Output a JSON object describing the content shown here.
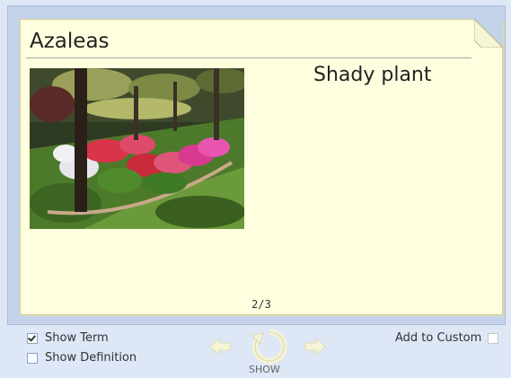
{
  "card": {
    "term": "Azaleas",
    "definition": "Shady plant",
    "counter": "2/3"
  },
  "controls": {
    "show_term_label": "Show Term",
    "show_term_checked": true,
    "show_definition_label": "Show Definition",
    "show_definition_checked": false,
    "add_to_custom_label": "Add to Custom",
    "add_to_custom_checked": false,
    "show_button_label": "SHOW",
    "prev_icon": "left-arrow-icon",
    "next_icon": "right-arrow-icon",
    "flip_icon": "flip-icon"
  }
}
